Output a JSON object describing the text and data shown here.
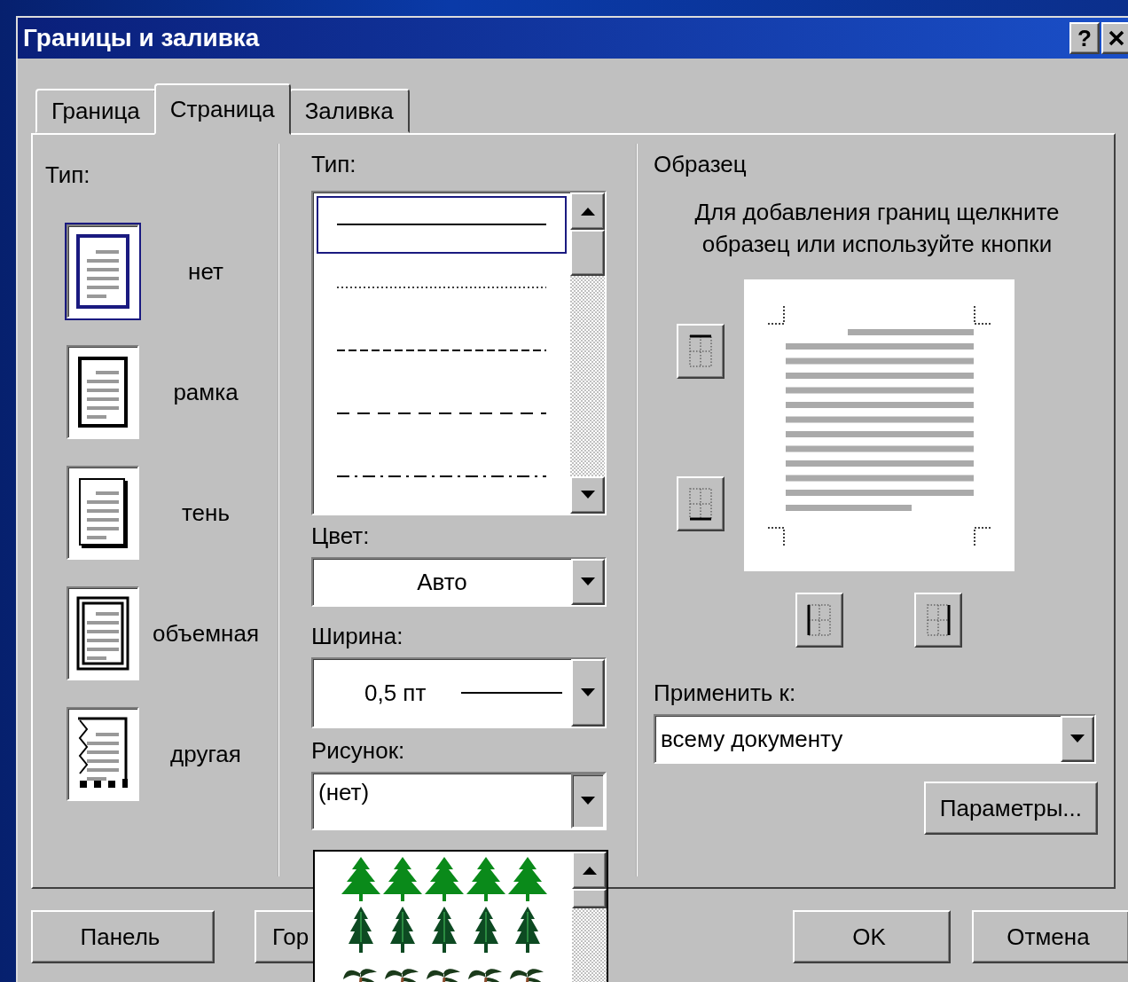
{
  "window": {
    "title": "Границы и заливка",
    "help": "?"
  },
  "tabs": [
    {
      "label": "Граница",
      "selected": false
    },
    {
      "label": "Страница",
      "selected": true
    },
    {
      "label": "Заливка",
      "selected": false
    }
  ],
  "setting": {
    "label": "Тип:",
    "options": [
      {
        "label": "нет",
        "kind": "none",
        "selected": true
      },
      {
        "label": "рамка",
        "kind": "box",
        "selected": false
      },
      {
        "label": "тень",
        "kind": "shadow",
        "selected": false
      },
      {
        "label": "объемная",
        "kind": "raised",
        "selected": false
      },
      {
        "label": "другая",
        "kind": "custom",
        "selected": false
      }
    ]
  },
  "style": {
    "label": "Тип:",
    "options": [
      {
        "kind": "solid",
        "selected": true
      },
      {
        "kind": "dotted",
        "selected": false
      },
      {
        "kind": "dashed",
        "selected": false
      },
      {
        "kind": "long-dashed",
        "selected": false
      },
      {
        "kind": "dash-dot",
        "selected": false
      }
    ]
  },
  "color": {
    "label": "Цвет:",
    "value": "Авто"
  },
  "width": {
    "label": "Ширина:",
    "value": "0,5 пт"
  },
  "art": {
    "label": "Рисунок:",
    "value": "(нет)",
    "expanded": true,
    "options": [
      {
        "kind": "fir"
      },
      {
        "kind": "spruce"
      },
      {
        "kind": "palm"
      }
    ]
  },
  "preview": {
    "title": "Образец",
    "hint": "Для добавления границ щелкните образец или используйте кнопки",
    "side_buttons": [
      {
        "kind": "top"
      },
      {
        "kind": "bottom"
      }
    ],
    "bottom_buttons": [
      {
        "kind": "left"
      },
      {
        "kind": "right"
      }
    ]
  },
  "apply_to": {
    "label": "Применить к:",
    "value": "всему документу"
  },
  "options_button": "Параметры...",
  "footer": {
    "left_buttons": [
      "Панель",
      "Гор"
    ],
    "right_buttons": [
      "OK",
      "Отмена"
    ]
  }
}
